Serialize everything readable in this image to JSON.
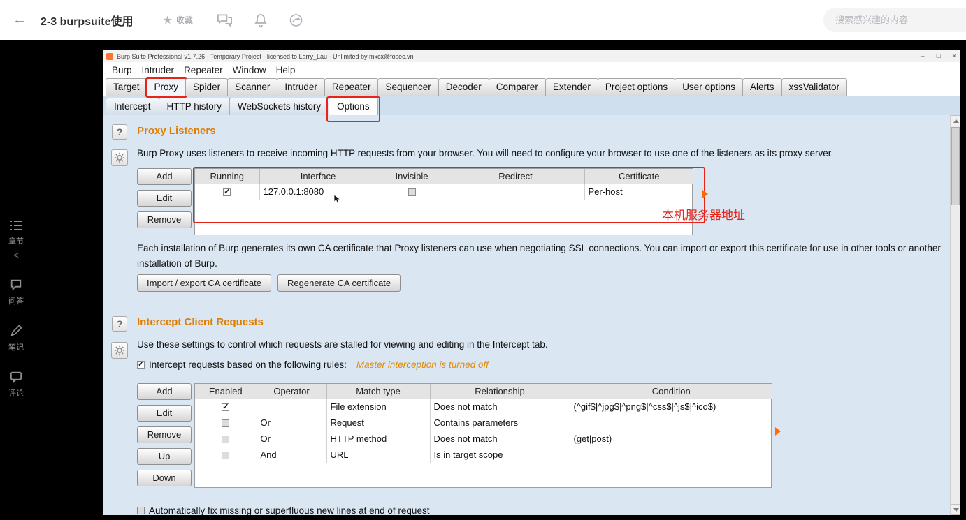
{
  "page": {
    "topbar": {
      "back_icon": "←",
      "title": "2-3 burpsuite使用",
      "favorite_label": "收藏",
      "star_icon": "★",
      "search_placeholder": "搜索感兴趣的内容"
    },
    "sidebar": {
      "collapse_icon": "<",
      "items": [
        {
          "label": "章节"
        },
        {
          "label": "问答"
        },
        {
          "label": "笔记"
        },
        {
          "label": "评论"
        }
      ]
    }
  },
  "burp": {
    "titlebar": {
      "title": "Burp Suite Professional v1.7.26 - Temporary Project - licensed to Larry_Lau - Unlimited by mxcx@fosec.vn",
      "minimize_icon": "–",
      "maximize_icon": "□",
      "close_icon": "×"
    },
    "menus": [
      "Burp",
      "Intruder",
      "Repeater",
      "Window",
      "Help"
    ],
    "tabs": [
      "Target",
      "Proxy",
      "Spider",
      "Scanner",
      "Intruder",
      "Repeater",
      "Sequencer",
      "Decoder",
      "Comparer",
      "Extender",
      "Project options",
      "User options",
      "Alerts",
      "xssValidator"
    ],
    "selected_tab": "Proxy",
    "subtabs": [
      "Intercept",
      "HTTP history",
      "WebSockets history",
      "Options"
    ],
    "selected_subtab": "Options",
    "help_icon": "?",
    "proxy_listeners": {
      "title": "Proxy Listeners",
      "description": "Burp Proxy uses listeners to receive incoming HTTP requests from your browser. You will need to configure your browser to use one of the listeners as its proxy server.",
      "buttons": [
        "Add",
        "Edit",
        "Remove"
      ],
      "table": {
        "headers": [
          "Running",
          "Interface",
          "Invisible",
          "Redirect",
          "Certificate"
        ],
        "rows": [
          {
            "running": true,
            "interface": "127.0.0.1:8080",
            "invisible": false,
            "redirect": "",
            "certificate": "Per-host"
          }
        ]
      },
      "ca_text": "Each installation of Burp generates its own CA certificate that Proxy listeners can use when negotiating SSL connections. You can import or export this certificate for use in other tools or another installation of Burp.",
      "ca_buttons": [
        "Import / export CA certificate",
        "Regenerate CA certificate"
      ]
    },
    "intercept_client_requests": {
      "title": "Intercept Client Requests",
      "description": "Use these settings to control which requests are stalled for viewing and editing in the Intercept tab.",
      "rules_checkbox_checked": true,
      "rules_checkbox_label": "Intercept requests based on the following rules:",
      "master_status": "Master interception is turned off",
      "buttons": [
        "Add",
        "Edit",
        "Remove",
        "Up",
        "Down"
      ],
      "table": {
        "headers": [
          "Enabled",
          "Operator",
          "Match type",
          "Relationship",
          "Condition"
        ],
        "rows": [
          {
            "enabled": true,
            "operator": "",
            "match_type": "File extension",
            "relationship": "Does not match",
            "condition": "(^gif$|^jpg$|^png$|^css$|^js$|^ico$)"
          },
          {
            "enabled": false,
            "operator": "Or",
            "match_type": "Request",
            "relationship": "Contains parameters",
            "condition": ""
          },
          {
            "enabled": false,
            "operator": "Or",
            "match_type": "HTTP method",
            "relationship": "Does not match",
            "condition": "(get|post)"
          },
          {
            "enabled": false,
            "operator": "And",
            "match_type": "URL",
            "relationship": "Is in target scope",
            "condition": ""
          }
        ]
      },
      "auto_fix_checked": false,
      "auto_fix_label": "Automatically fix missing or superfluous new lines at end of request"
    },
    "annotations": {
      "color": "#e8231a",
      "server_note": "本机服务器地址"
    }
  }
}
